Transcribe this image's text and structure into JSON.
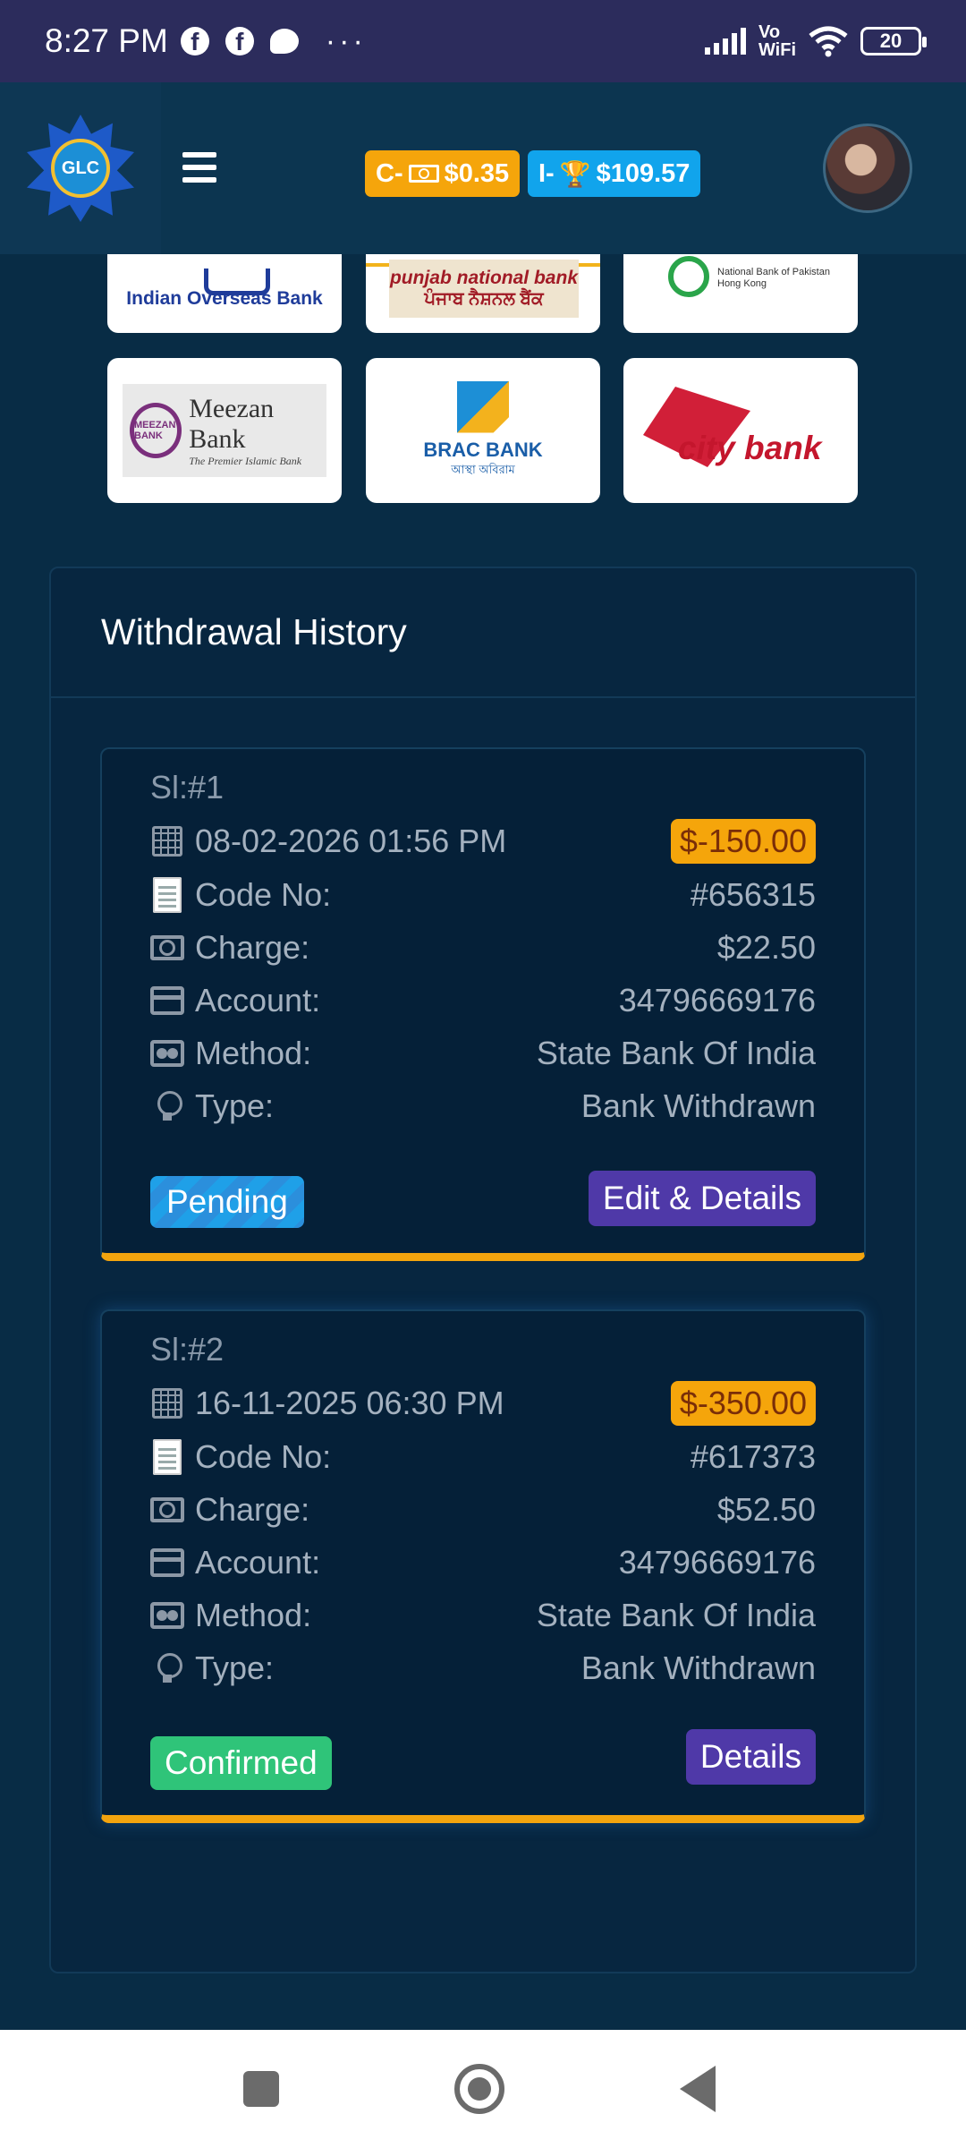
{
  "status_bar": {
    "time": "8:27 PM",
    "vowifi_line1": "Vo",
    "vowifi_line2": "WiFi",
    "battery": "20",
    "more": "···"
  },
  "header": {
    "logo_text": "GLC",
    "coin_badge": {
      "prefix": "C-",
      "value": "$0.35"
    },
    "income_badge": {
      "prefix": "I-",
      "value": "$109.57"
    }
  },
  "banks": [
    {
      "name": "Indian Overseas Bank"
    },
    {
      "name_line1": "punjab national bank",
      "name_line2": "ਪੰਜਾਬ ਨੈਸ਼ਨਲ ਬੈਂਕ"
    },
    {
      "name_line1": "National Bank of Pakistan",
      "name_line2": "Hong Kong"
    },
    {
      "name": "Meezan Bank",
      "tagline": "The Premier Islamic Bank",
      "seal": "MEEZAN BANK"
    },
    {
      "name": "BRAC BANK",
      "tagline": "আস্থা অবিরাম"
    },
    {
      "name": "city bank"
    }
  ],
  "withdrawal_history": {
    "title": "Withdrawal History",
    "labels": {
      "code": "Code No:",
      "charge": "Charge:",
      "account": "Account:",
      "method": "Method:",
      "type": "Type:"
    },
    "items": [
      {
        "sl": "Sl:#1",
        "datetime": "08-02-2026 01:56 PM",
        "amount": "$-150.00",
        "code": "#656315",
        "charge": "$22.50",
        "account": "34796669176",
        "method": "State Bank Of India",
        "type": "Bank Withdrawn",
        "status": "Pending",
        "action": "Edit & Details"
      },
      {
        "sl": "Sl:#2",
        "datetime": "16-11-2025 06:30 PM",
        "amount": "$-350.00",
        "code": "#617373",
        "charge": "$52.50",
        "account": "34796669176",
        "method": "State Bank Of India",
        "type": "Bank Withdrawn",
        "status": "Confirmed",
        "action": "Details"
      }
    ]
  },
  "icons": [
    "facebook-icon",
    "message-icon",
    "signal-icon",
    "wifi-icon",
    "battery-icon",
    "menu-icon",
    "cash-icon",
    "trophy-icon",
    "calendar-icon",
    "document-icon",
    "credit-card-icon",
    "payment-card-icon",
    "lightbulb-icon",
    "recents-icon",
    "home-icon",
    "back-icon"
  ],
  "colors": {
    "background": "#082c45",
    "header": "#0c3550",
    "accent_orange": "#f5a50b",
    "accent_blue": "#11a4ec",
    "pending": "#1fa0e8",
    "confirmed": "#2fc479",
    "details_button": "#4f39a8"
  }
}
